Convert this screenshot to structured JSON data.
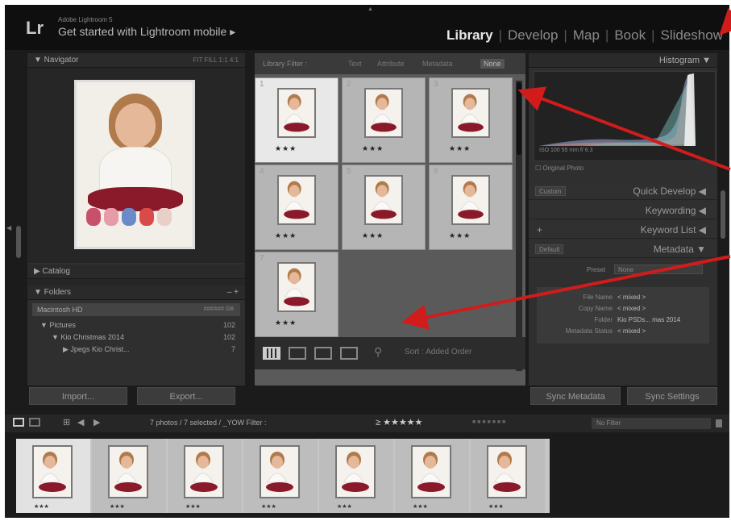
{
  "app": {
    "logo": "Lr",
    "product_name": "Adobe Lightroom 5",
    "mobile_prompt": "Get started with Lightroom mobile ▸"
  },
  "modules": [
    "Library",
    "Develop",
    "Map",
    "Book",
    "Slideshow"
  ],
  "navigator": {
    "title": "▼ Navigator",
    "zoom_options": "FIT  FILL  1:1  4:1"
  },
  "left_panel": {
    "catalog": "▶ Catalog",
    "folders": "▼ Folders",
    "folders_controls": "–  +",
    "volume": "Macintosh HD",
    "volume_size": "###/### GB",
    "folder_rows": [
      {
        "label": "▼  Pictures",
        "count": "102"
      },
      {
        "label": "▼  Kio Christmas 2014",
        "count": "102"
      },
      {
        "label": "▶  Jpegs Kio Christ...",
        "count": "7"
      }
    ],
    "import_label": "Import...",
    "export_label": "Export..."
  },
  "library_filter": {
    "label": "Library Filter :",
    "options": [
      "Text",
      "Attribute",
      "Metadata",
      "None"
    ]
  },
  "grid": {
    "cells": [
      {
        "num": "1",
        "stars": "★★★",
        "selected": true
      },
      {
        "num": "2",
        "stars": "★★★",
        "selected": false
      },
      {
        "num": "3",
        "stars": "★★★",
        "selected": false
      },
      {
        "num": "4",
        "stars": "★★★",
        "selected": false
      },
      {
        "num": "5",
        "stars": "★★★",
        "selected": false
      },
      {
        "num": "6",
        "stars": "★★★",
        "selected": false
      },
      {
        "num": "7",
        "stars": "★★★",
        "selected": false
      }
    ]
  },
  "toolbar": {
    "sort_label": "Sort : Added Order"
  },
  "right_panel": {
    "histogram": "Histogram ▼",
    "histogram_info": "ISO 100    55 mm    f/ 6.3    ",
    "original_photo": "☐ Original Photo",
    "quick_develop": "Quick Develop ◀",
    "saved_preset": "Custom",
    "keywording": "Keywording ◀",
    "keyword_list": "Keyword List ◀",
    "keyword_plus": "+",
    "metadata": "Metadata ▼",
    "metadata_preset_btn": "Default",
    "preset_label": "Preset",
    "preset_value": "None",
    "meta_rows": [
      {
        "key": "File Name",
        "value": "< mixed >"
      },
      {
        "key": "Copy Name",
        "value": "< mixed >"
      },
      {
        "key": "Folder",
        "value": "Kio PSDs... mas 2014"
      },
      {
        "key": "Metadata Status",
        "value": "< mixed >"
      }
    ],
    "sync_metadata": "Sync Metadata",
    "sync_settings": "Sync Settings"
  },
  "filmbar": {
    "status": "7 photos / 7 selected / _YOW  Filter :",
    "rating_filter": "≥ ★★★★★",
    "no_filter": "No Filter"
  },
  "filmstrip": {
    "frames": [
      {
        "selected": true
      },
      {
        "selected": false
      },
      {
        "selected": false
      },
      {
        "selected": false
      },
      {
        "selected": false
      },
      {
        "selected": false
      },
      {
        "selected": false
      }
    ]
  },
  "colors": {
    "app_bg": "#1b1b1b",
    "annotation_arrow": "#d21b1b",
    "active_module": "#e8e8e8"
  }
}
